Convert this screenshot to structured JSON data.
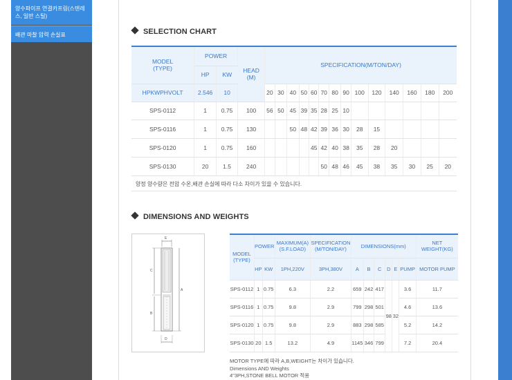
{
  "sidebar": {
    "items": [
      {
        "label": "양수파이프 연결카프링(스텐레스, 일반 스틸)"
      },
      {
        "label": "배관 마찰 압력 손실표"
      }
    ]
  },
  "selection": {
    "title": "SELECTION CHART",
    "headers": {
      "model": "MODEL",
      "type": "(TYPE)",
      "power": "POWER",
      "hp": "HP",
      "kw": "KW",
      "head": "HEAD",
      "head_unit": "(M)",
      "spec": "SPECIFICATION(M/TON/DAY)",
      "hpkwphvolt": "HPKWPHVOLT",
      "hp_val": "2.546",
      "kw_val": "10"
    },
    "flows": [
      "20",
      "30",
      "40",
      "50",
      "60",
      "70",
      "80",
      "90",
      "100",
      "120",
      "140",
      "160",
      "180",
      "200"
    ],
    "rows": [
      {
        "model": "SPS-0112",
        "hp": "1",
        "kw": "0.75",
        "head": "100",
        "vals": [
          "56",
          "50",
          "45",
          "39",
          "35",
          "28",
          "25",
          "10",
          "",
          "",
          "",
          "",
          "",
          ""
        ]
      },
      {
        "model": "SPS-0116",
        "hp": "1",
        "kw": "0.75",
        "head": "130",
        "vals": [
          "",
          "",
          "50",
          "48",
          "42",
          "39",
          "36",
          "30",
          "28",
          "15",
          "",
          "",
          "",
          ""
        ]
      },
      {
        "model": "SPS-0120",
        "hp": "1",
        "kw": "0.75",
        "head": "160",
        "vals": [
          "",
          "",
          "",
          "",
          "45",
          "42",
          "40",
          "38",
          "35",
          "28",
          "20",
          "",
          "",
          ""
        ]
      },
      {
        "model": "SPS-0130",
        "hp": "20",
        "kw": "1.5",
        "head": "240",
        "vals": [
          "",
          "",
          "",
          "",
          "",
          "50",
          "48",
          "46",
          "45",
          "38",
          "35",
          "30",
          "25",
          "20"
        ]
      }
    ],
    "note": "양정 양수량은 전압 수온,배관 손실에 따라 다소 차이가 있을 수 있습니다."
  },
  "dimensions": {
    "title": "DIMENSIONS AND WEIGHTS",
    "headers": {
      "model": "MODEL",
      "type": "(TYPE)",
      "power": "POWER",
      "maximum": "MAXIMUM(A)",
      "sfload": "(S.F.LOAD)",
      "specification": "SPECIFICATION",
      "spec_unit": "(M/TON/DAY)",
      "dimensions": "DIMENSIONS(mm)",
      "net_weight": "NET WEIGHT(KG)",
      "hp": "HP",
      "kw": "KW",
      "ph220": "1PH,220V",
      "ph380": "3PH,380V",
      "a": "A",
      "b": "B",
      "c": "C",
      "d": "D",
      "e": "E",
      "pump": "PUMP",
      "motor_pump": "MOTOR PUMP"
    },
    "d_val": "98",
    "e_val": "32",
    "rows": [
      {
        "model": "SPS-0112",
        "hp": "1",
        "kw": "0.75",
        "ph220": "6.3",
        "ph380": "2.2",
        "a": "659",
        "b": "242",
        "c": "417",
        "pump": "3.6",
        "motor_pump": "11.7"
      },
      {
        "model": "SPS-0116",
        "hp": "1",
        "kw": "0.75",
        "ph220": "9.8",
        "ph380": "2.9",
        "a": "799",
        "b": "298",
        "c": "501",
        "pump": "4.6",
        "motor_pump": "13.6"
      },
      {
        "model": "SPS-0120",
        "hp": "1",
        "kw": "0.75",
        "ph220": "9.8",
        "ph380": "2.9",
        "a": "883",
        "b": "298",
        "c": "585",
        "pump": "5.2",
        "motor_pump": "14.2"
      },
      {
        "model": "SPS-0130",
        "hp": "20",
        "kw": "1.5",
        "ph220": "13.2",
        "ph380": "4.9",
        "a": "1145",
        "b": "346",
        "c": "799",
        "pump": "7.2",
        "motor_pump": "20.4"
      }
    ],
    "notes": [
      "MOTOR TYPE에 따라 A,B,WEIGHT는 차이가 있습니다.",
      "Dimensions AND Weights",
      "4\"3PH,STONE BELL MOTOR 적용"
    ],
    "diagram_labels": {
      "e": "E",
      "c": "C",
      "a": "A",
      "b": "B",
      "d": "D"
    }
  },
  "colors": {
    "accent": "#3a7fd0",
    "header_bg": "#eaf2fb",
    "sidebar_bg": "#4d4d4d",
    "menu_bg": "#3a8ce0"
  }
}
